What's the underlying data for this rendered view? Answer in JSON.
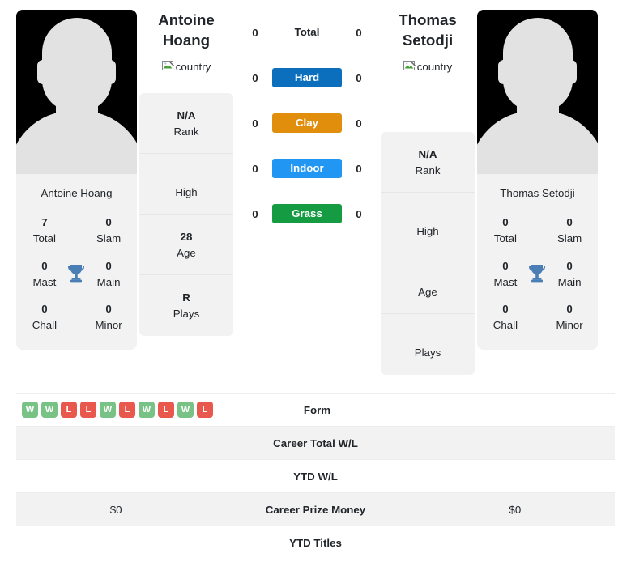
{
  "players": {
    "left": {
      "name": "Antoine Hoang",
      "name_line1": "Antoine",
      "name_line2": "Hoang",
      "country_alt": "country",
      "photo_alt": "Antoine Hoang",
      "card_name": "Antoine Hoang",
      "stats": [
        {
          "value": "7",
          "label": "Total"
        },
        {
          "value": "0",
          "label": "Slam"
        },
        {
          "value": "0",
          "label": "Mast"
        },
        {
          "value": "0",
          "label": "Main"
        },
        {
          "value": "0",
          "label": "Chall"
        },
        {
          "value": "0",
          "label": "Minor"
        }
      ],
      "info": [
        {
          "value": "N/A",
          "label": "Rank"
        },
        {
          "value": "",
          "label": "High"
        },
        {
          "value": "28",
          "label": "Age"
        },
        {
          "value": "R",
          "label": "Plays"
        }
      ]
    },
    "right": {
      "name": "Thomas Setodji",
      "name_line1": "Thomas",
      "name_line2": "Setodji",
      "country_alt": "country",
      "photo_alt": "Thomas Setodji",
      "card_name": "Thomas Setodji",
      "stats": [
        {
          "value": "0",
          "label": "Total"
        },
        {
          "value": "0",
          "label": "Slam"
        },
        {
          "value": "0",
          "label": "Mast"
        },
        {
          "value": "0",
          "label": "Main"
        },
        {
          "value": "0",
          "label": "Chall"
        },
        {
          "value": "0",
          "label": "Minor"
        }
      ],
      "info": [
        {
          "value": "N/A",
          "label": "Rank"
        },
        {
          "value": "",
          "label": "High"
        },
        {
          "value": "",
          "label": "Age"
        },
        {
          "value": "",
          "label": "Plays"
        }
      ]
    }
  },
  "surfaces": [
    {
      "label": "Total",
      "left": "0",
      "right": "0",
      "color": ""
    },
    {
      "label": "Hard",
      "left": "0",
      "right": "0",
      "color": "#0b6fbd"
    },
    {
      "label": "Clay",
      "left": "0",
      "right": "0",
      "color": "#e08e0b"
    },
    {
      "label": "Indoor",
      "left": "0",
      "right": "0",
      "color": "#2196f3"
    },
    {
      "label": "Grass",
      "left": "0",
      "right": "0",
      "color": "#159c43"
    }
  ],
  "table": {
    "rows": [
      {
        "label": "Form",
        "left": "",
        "right": "",
        "type": "form"
      },
      {
        "label": "Career Total W/L",
        "left": "",
        "right": "",
        "type": "text"
      },
      {
        "label": "YTD W/L",
        "left": "",
        "right": "",
        "type": "text"
      },
      {
        "label": "Career Prize Money",
        "left": "$0",
        "right": "$0",
        "type": "text"
      },
      {
        "label": "YTD Titles",
        "left": "",
        "right": "",
        "type": "text"
      }
    ],
    "form_left": [
      "W",
      "W",
      "L",
      "L",
      "W",
      "L",
      "W",
      "L",
      "W",
      "L"
    ],
    "form_right": []
  },
  "colors": {
    "trophy": "#4a7eb5",
    "win_badge": "#78c286",
    "loss_badge": "#e8584c",
    "card_bg": "#f2f2f2",
    "photo_bg": "#000000"
  }
}
